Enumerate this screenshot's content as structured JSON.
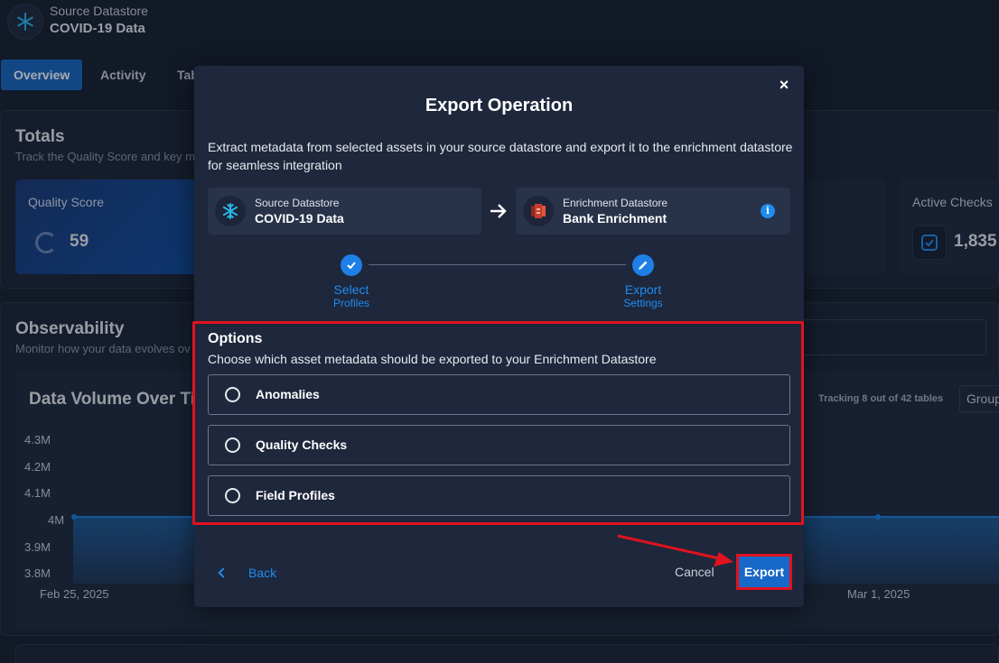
{
  "header": {
    "subtitle": "Source Datastore",
    "title": "COVID-19 Data"
  },
  "tabs": [
    {
      "label": "Overview",
      "active": true
    },
    {
      "label": "Activity",
      "active": false
    },
    {
      "label": "Tab",
      "active": false
    }
  ],
  "totals": {
    "title": "Totals",
    "subtitle": "Track the Quality Score and key m",
    "quality_score_label": "Quality Score",
    "quality_score_value": "59",
    "active_checks_label": "Active Checks",
    "active_checks_value": "1,835"
  },
  "observability": {
    "title": "Observability",
    "subtitle": "Monitor how your data evolves ov",
    "chart_title": "Data Volume Over Tim",
    "tracking_text": "Tracking 8 out of 42 tables",
    "group_label": "Group"
  },
  "chart_data": {
    "type": "area",
    "title": "Data Volume Over Tim",
    "y_ticks": [
      "4.3M",
      "4.2M",
      "4.1M",
      "4M",
      "3.9M",
      "3.8M"
    ],
    "x_ticks": [
      "Feb 25, 2025",
      "Mar 1, 2025"
    ],
    "ylim": [
      3800000,
      4300000
    ],
    "series": [
      {
        "values": [
          4000000,
          4000000
        ]
      }
    ]
  },
  "modal": {
    "close_label": "×",
    "title": "Export Operation",
    "description": "Extract metadata from selected assets in your source datastore and export it to the enrichment datastore for seamless integration",
    "source": {
      "label": "Source Datastore",
      "value": "COVID-19 Data"
    },
    "enrichment": {
      "label": "Enrichment Datastore",
      "value": "Bank Enrichment"
    },
    "info_icon": "i",
    "steps": [
      {
        "line1": "Select",
        "line2": "Profiles",
        "state": "done"
      },
      {
        "line1": "Export",
        "line2": "Settings",
        "state": "current"
      }
    ],
    "options_title": "Options",
    "options_subtitle": "Choose which asset metadata should be exported to your Enrichment Datastore",
    "options": [
      {
        "label": "Anomalies",
        "selected": false
      },
      {
        "label": "Quality Checks",
        "selected": false
      },
      {
        "label": "Field Profiles",
        "selected": false
      }
    ],
    "back_label": "Back",
    "cancel_label": "Cancel",
    "export_label": "Export"
  },
  "colors": {
    "accent": "#1e7fe6",
    "highlight": "#e0131f",
    "modal_bg": "#1e273b",
    "page_bg": "#181f30"
  },
  "icons": {
    "source_logo": "snowflake-icon",
    "enrichment_logo": "redshift-icon",
    "arrow": "arrow-right-icon",
    "back": "chevron-left-icon",
    "close": "close-icon"
  }
}
